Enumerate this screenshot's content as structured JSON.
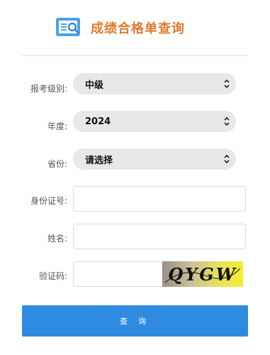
{
  "header": {
    "title": "成绩合格单查询",
    "logo_icon": "search-document-icon",
    "logo_color": "#3a8fe0",
    "title_color": "#e07a2e"
  },
  "form": {
    "level": {
      "label": "报考级别:",
      "value": "中级"
    },
    "year": {
      "label": "年度:",
      "value": "2024"
    },
    "province": {
      "label": "省份:",
      "value": "请选择"
    },
    "id_number": {
      "label": "身份证号:",
      "value": ""
    },
    "name": {
      "label": "姓名:",
      "value": ""
    },
    "captcha": {
      "label": "验证码:",
      "value": "",
      "image_text": "QYGW"
    }
  },
  "submit": {
    "label": "查 询",
    "color": "#2f8be0"
  }
}
